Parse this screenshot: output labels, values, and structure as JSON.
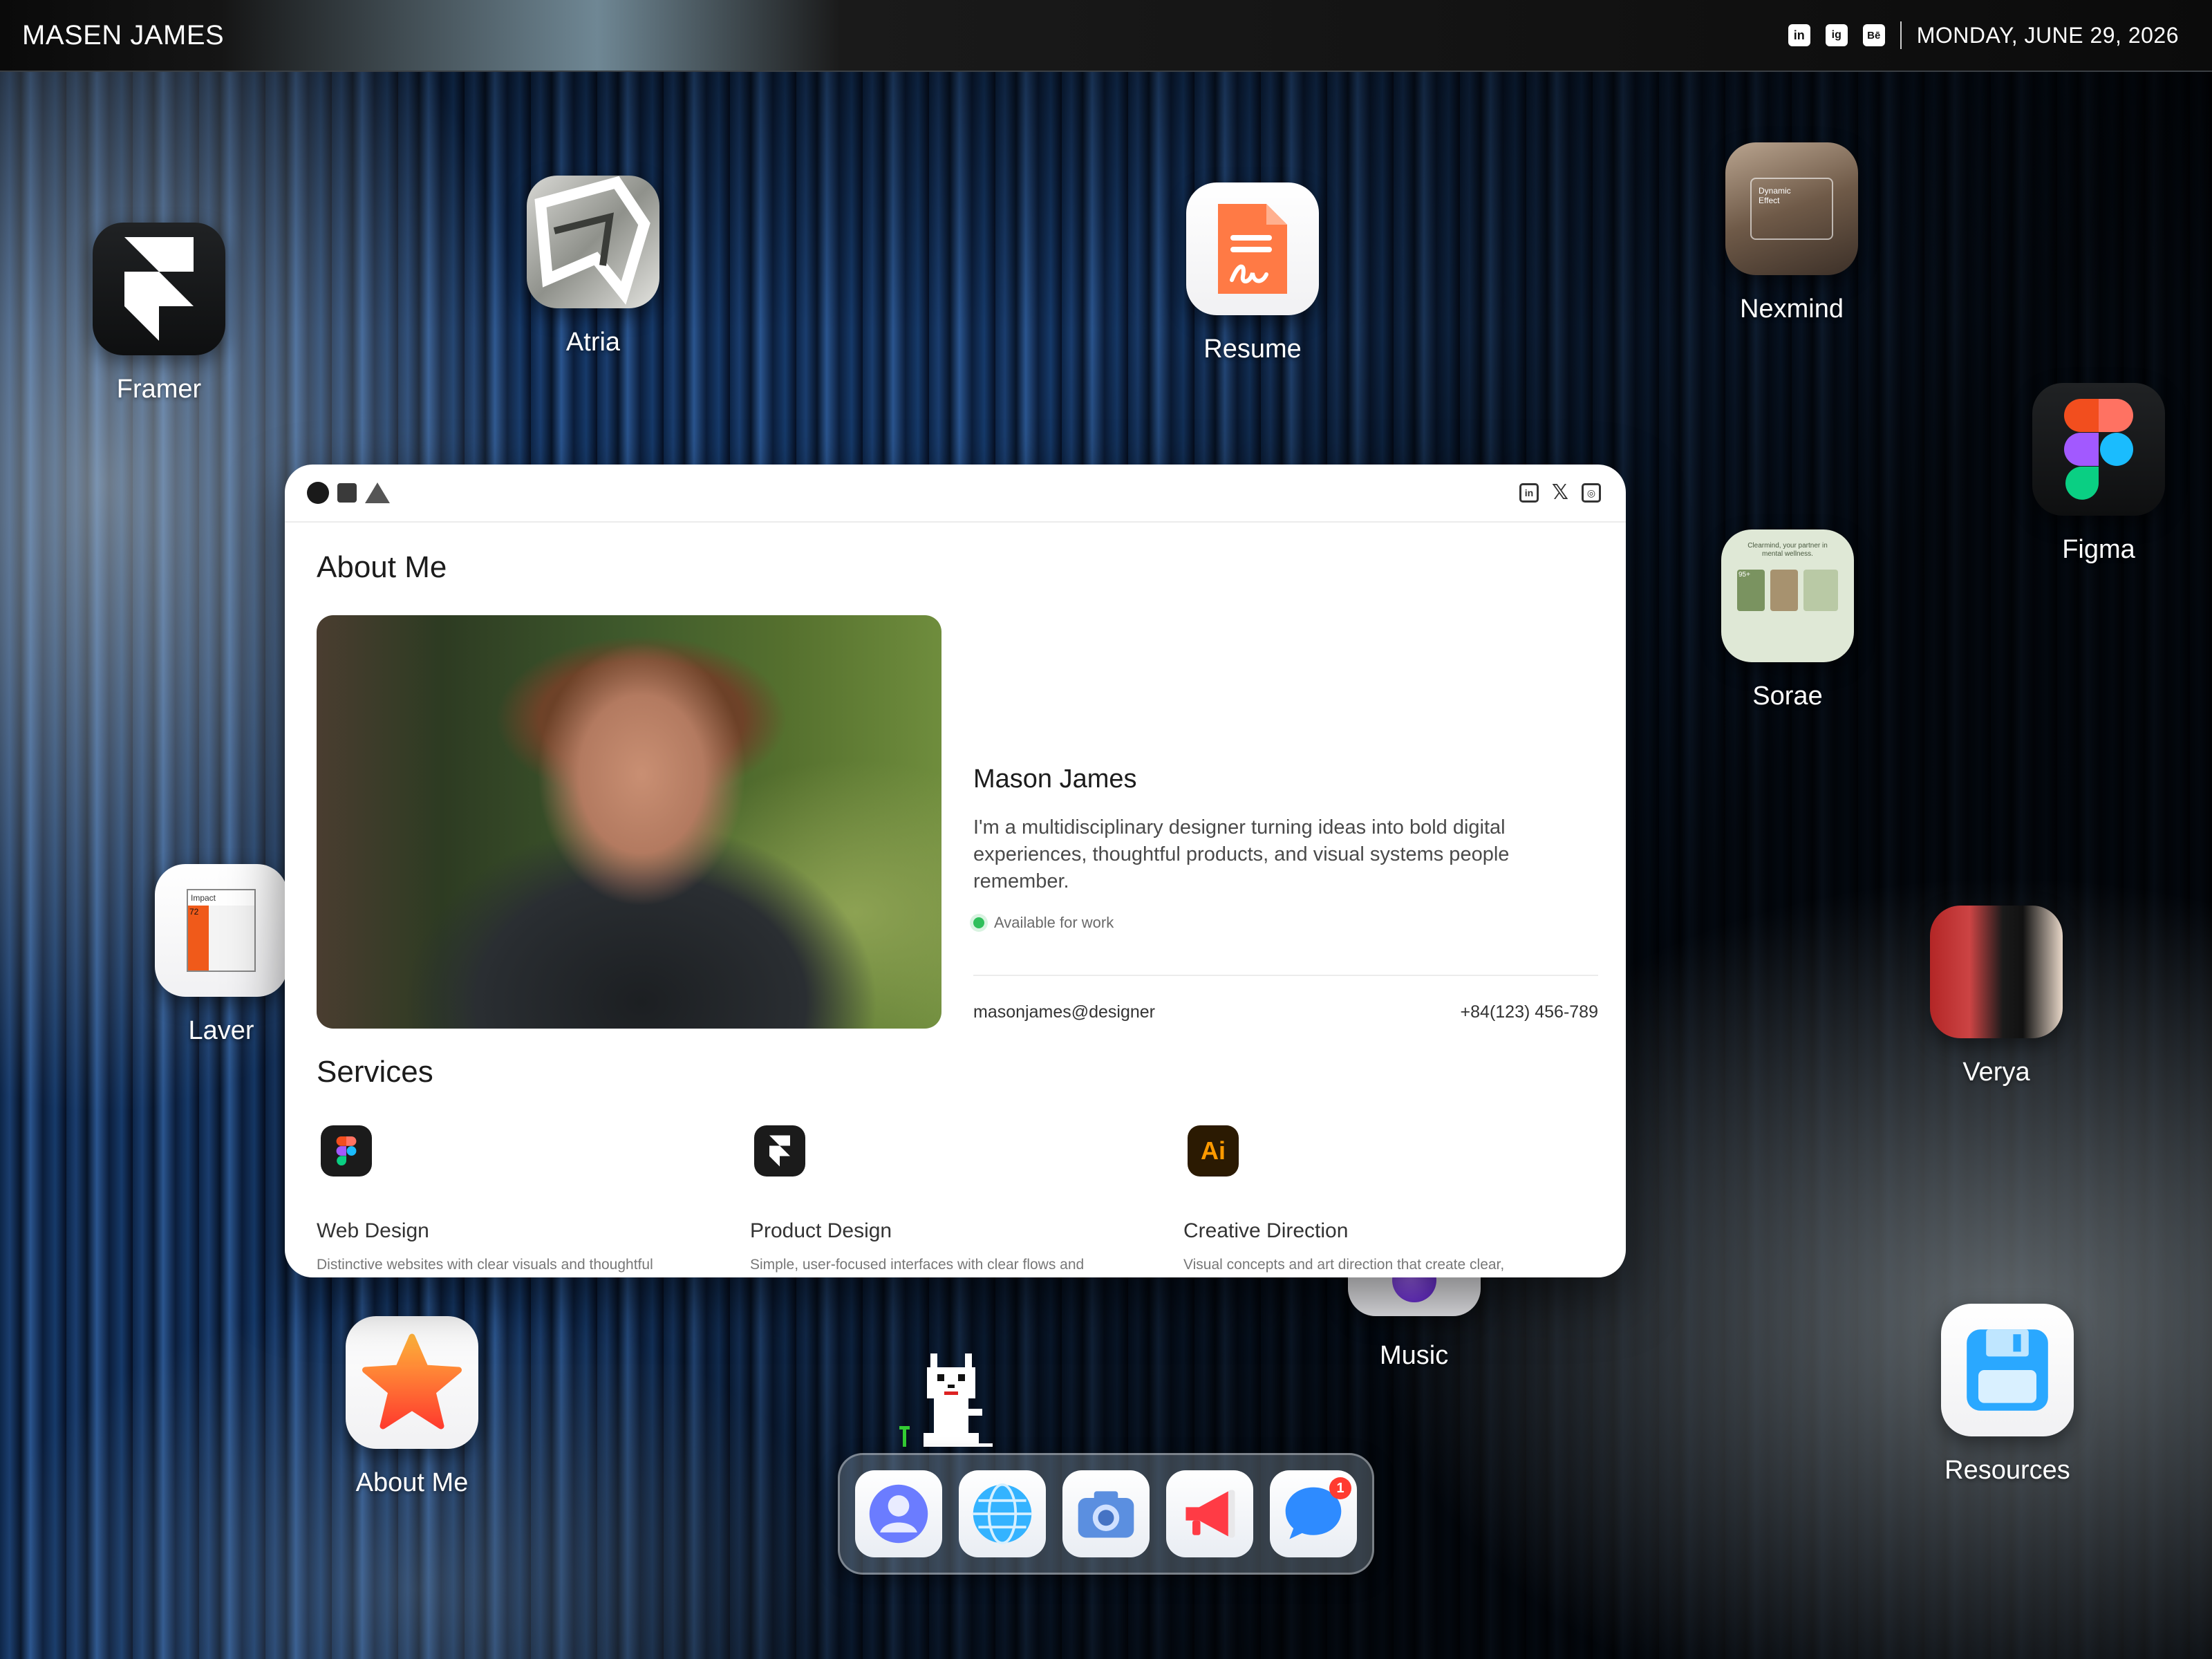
{
  "topbar": {
    "brand": "MASEN JAMES",
    "social": [
      "in",
      "ig",
      "Bē"
    ],
    "date": "MONDAY, JUNE 29, 2026"
  },
  "apps": {
    "framer": "Framer",
    "atria": "Atria",
    "resume": "Resume",
    "nexmind": "Nexmind",
    "figma": "Figma",
    "sorae": "Sorae",
    "laver": "Laver",
    "verya": "Verya",
    "about": "About Me",
    "music": "Music",
    "resources": "Resources"
  },
  "tile_text": {
    "nexmind_1": "Dynamic",
    "nexmind_2": "Effect",
    "sorae_1": "Clearmind, your partner in",
    "sorae_2": "mental wellness.",
    "sorae_stat": "95+",
    "laver_1": "Impact",
    "laver_2": "72"
  },
  "window": {
    "social": [
      "in",
      "𝕏",
      "◎"
    ],
    "about_title": "About Me",
    "name": "Mason James",
    "bio": "I'm a multidisciplinary designer turning ideas into bold digital experiences, thoughtful products, and visual systems people remember.",
    "availability": "Available for work",
    "email": "masonjames@designer",
    "phone": "+84(123) 456-789",
    "services_title": "Services",
    "services": [
      {
        "title": "Web Design",
        "desc": "Distinctive websites with clear visuals and thoughtful"
      },
      {
        "title": "Product Design",
        "desc": "Simple, user-focused interfaces with clear flows and"
      },
      {
        "title": "Creative Direction",
        "desc": "Visual concepts and art direction that create clear,"
      }
    ],
    "ai_icon_text": "Ai"
  },
  "dock": {
    "messages_badge": "1"
  },
  "colors": {
    "accent_resume": "#ff7a45",
    "available_green": "#2fbf5b",
    "badge_red": "#ff3b30"
  }
}
